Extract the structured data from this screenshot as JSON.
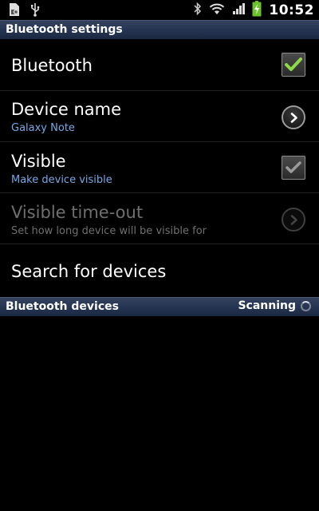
{
  "status_bar": {
    "time": "10:52",
    "icons": [
      "sd-card-icon",
      "usb-icon",
      "bluetooth-icon",
      "wifi-icon",
      "signal-icon",
      "battery-charging-icon"
    ]
  },
  "header": {
    "title": "Bluetooth settings"
  },
  "settings": [
    {
      "title": "Bluetooth",
      "subtitle": "",
      "control": "checkbox",
      "checked": true,
      "enabled": true
    },
    {
      "title": "Device name",
      "subtitle": "Galaxy Note",
      "control": "chevron",
      "enabled": true
    },
    {
      "title": "Visible",
      "subtitle": "Make device visible",
      "control": "checkbox",
      "checked": true,
      "enabled": true
    },
    {
      "title": "Visible time-out",
      "subtitle": "Set how long device will be visible for",
      "control": "chevron",
      "enabled": false
    },
    {
      "title": "Search for devices",
      "subtitle": "",
      "control": "none",
      "enabled": true
    }
  ],
  "devices_section": {
    "title": "Bluetooth devices",
    "status": "Scanning"
  },
  "colors": {
    "accent_check": "#8ed84a",
    "subtitle_blue": "#75a9e6",
    "header_bg": "#243350"
  }
}
